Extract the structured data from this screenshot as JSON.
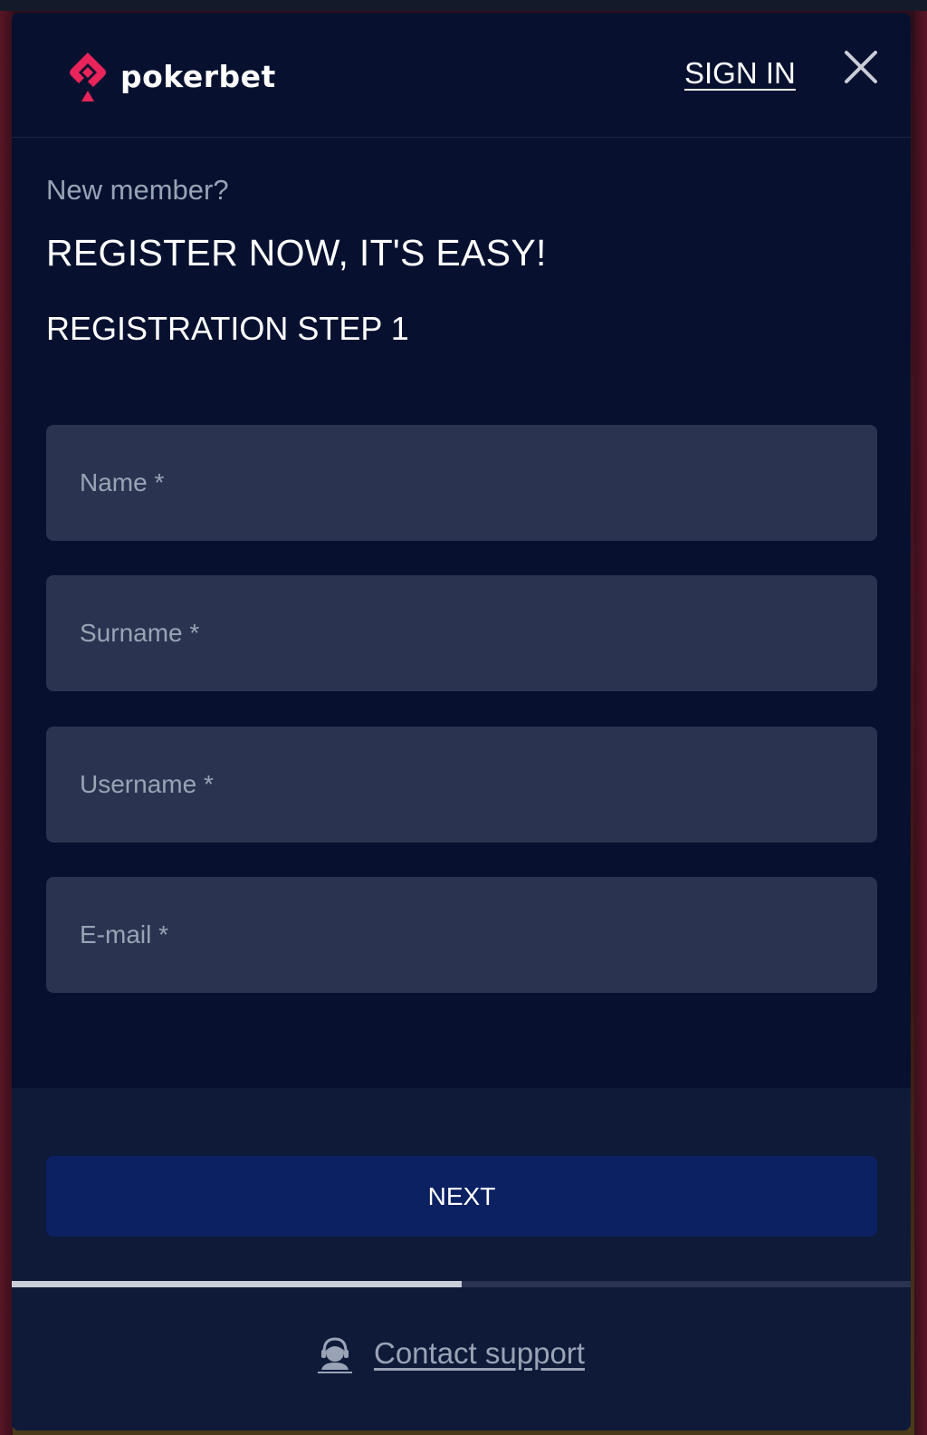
{
  "brand": {
    "name": "pokerbet",
    "accent_color": "#e8245a"
  },
  "header": {
    "sign_in_label": "SIGN IN",
    "close_icon": "close-icon"
  },
  "intro": {
    "new_member": "New member?",
    "headline": "REGISTER NOW, IT'S EASY!",
    "step_title": "REGISTRATION STEP 1"
  },
  "form": {
    "fields": [
      {
        "placeholder": "Name *",
        "value": ""
      },
      {
        "placeholder": "Surname *",
        "value": ""
      },
      {
        "placeholder": "Username *",
        "value": ""
      },
      {
        "placeholder": "E-mail *",
        "value": ""
      }
    ],
    "next_label": "NEXT"
  },
  "progress": {
    "fraction": 0.5
  },
  "support": {
    "label": "Contact support",
    "icon": "support-agent-icon"
  }
}
